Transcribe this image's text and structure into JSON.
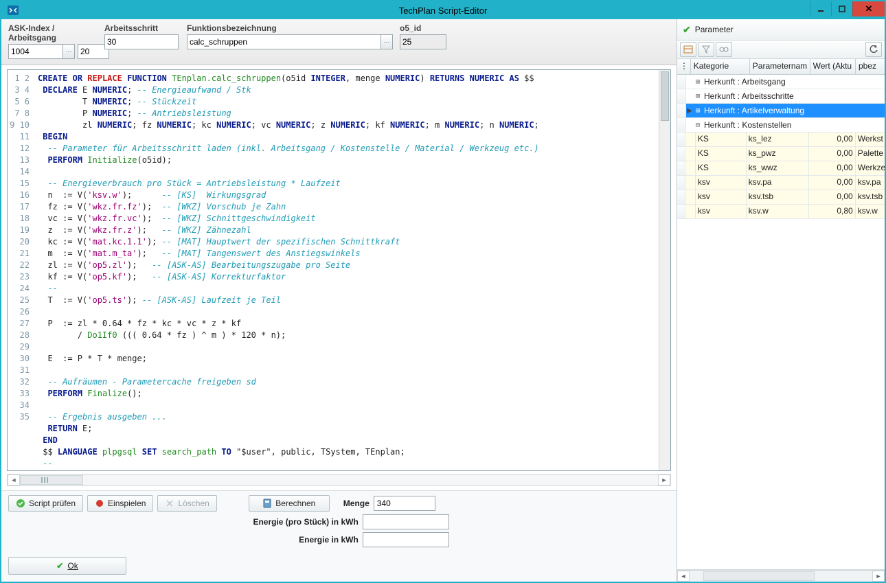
{
  "window": {
    "title": "TechPlan Script-Editor"
  },
  "form": {
    "ask_index": {
      "label": "ASK-Index / Arbeitsgang",
      "value": "1004"
    },
    "arbeitsgang": {
      "value": "20"
    },
    "arbeitsschritt": {
      "label": "Arbeitsschritt",
      "value": "30"
    },
    "funktion": {
      "label": "Funktionsbezeichnung",
      "value": "calc_schruppen"
    },
    "o5_id": {
      "label": "o5_id",
      "value": "25"
    }
  },
  "editor": {
    "lines": [
      "CREATE OR REPLACE FUNCTION TEnplan.calc_schruppen(o5id INTEGER, menge NUMERIC) RETURNS NUMERIC AS $$",
      " DECLARE E NUMERIC; -- Energieaufwand / Stk",
      "         T NUMERIC; -- Stückzeit",
      "         P NUMERIC; -- Antriebsleistung",
      "         zl NUMERIC; fz NUMERIC; kc NUMERIC; vc NUMERIC; z NUMERIC; kf NUMERIC; m NUMERIC; n NUMERIC;",
      " BEGIN",
      "  -- Parameter für Arbeitsschritt laden (inkl. Arbeitsgang / Kostenstelle / Material / Werkzeug etc.)",
      "  PERFORM Initialize(o5id);",
      "",
      "  -- Energieverbrauch pro Stück = Antriebsleistung * Laufzeit",
      "  n  := V('ksv.w');      -- [KS]  Wirkungsgrad",
      "  fz := V('wkz.fr.fz');  -- [WKZ] Vorschub je Zahn",
      "  vc := V('wkz.fr.vc');  -- [WKZ] Schnittgeschwindigkeit",
      "  z  := V('wkz.fr.z');   -- [WKZ] Zähnezahl",
      "  kc := V('mat.kc.1.1'); -- [MAT] Hauptwert der spezifischen Schnittkraft",
      "  m  := V('mat.m_ta');   -- [MAT] Tangenswert des Anstiegswinkels",
      "  zl := V('op5.zl');   -- [ASK-AS] Bearbeitungszugabe pro Seite",
      "  kf := V('op5.kf');   -- [ASK-AS] Korrekturfaktor",
      "  --",
      "  T  := V('op5.ts'); -- [ASK-AS] Laufzeit je Teil",
      "",
      "  P  := zl * 0.64 * fz * kc * vc * z * kf",
      "        / Do1If0 ((( 0.64 * fz ) ^ m ) * 120 * n);",
      "",
      "  E  := P * T * menge;",
      "",
      "  -- Aufräumen - Parametercache freigeben sd",
      "  PERFORM Finalize();",
      "",
      "  -- Ergebnis ausgeben ...",
      "  RETURN E;",
      " END",
      " $$ LANGUAGE plpgsql SET search_path TO \"$user\", public, TSystem, TEnplan;",
      " --",
      ""
    ]
  },
  "actions": {
    "script_pruefen": "Script prüfen",
    "einspielen": "Einspielen",
    "loeschen": "Löschen",
    "berechnen": "Berechnen",
    "ok": "Ok"
  },
  "calc": {
    "menge": {
      "label": "Menge",
      "value": "340"
    },
    "energie_pro_stueck": {
      "label": "Energie (pro Stück) in kWh",
      "value": ""
    },
    "energie": {
      "label": "Energie in kWh",
      "value": ""
    }
  },
  "side": {
    "title": "Parameter",
    "columns": {
      "kategorie": "Kategorie",
      "parametername": "Parameternam",
      "wert": "Wert (Aktu",
      "pbez": "pbez"
    },
    "groups": [
      {
        "label": "Herkunft : Arbeitsgang",
        "expanded": false,
        "selected": false
      },
      {
        "label": "Herkunft : Arbeitsschritte",
        "expanded": false,
        "selected": false
      },
      {
        "label": "Herkunft : Artikelverwaltung",
        "expanded": false,
        "selected": true
      },
      {
        "label": "Herkunft : Kostenstellen",
        "expanded": true,
        "selected": false
      }
    ],
    "rows": [
      {
        "kategorie": "KS",
        "pname": "ks_lez",
        "wert": "0,00",
        "pbez": "Werkst"
      },
      {
        "kategorie": "KS",
        "pname": "ks_pwz",
        "wert": "0,00",
        "pbez": "Palette"
      },
      {
        "kategorie": "KS",
        "pname": "ks_wwz",
        "wert": "0,00",
        "pbez": "Werkze"
      },
      {
        "kategorie": "ksv",
        "pname": "ksv.pa",
        "wert": "0,00",
        "pbez": "ksv.pa"
      },
      {
        "kategorie": "ksv",
        "pname": "ksv.tsb",
        "wert": "0,00",
        "pbez": "ksv.tsb"
      },
      {
        "kategorie": "ksv",
        "pname": "ksv.w",
        "wert": "0,80",
        "pbez": "ksv.w"
      }
    ]
  }
}
